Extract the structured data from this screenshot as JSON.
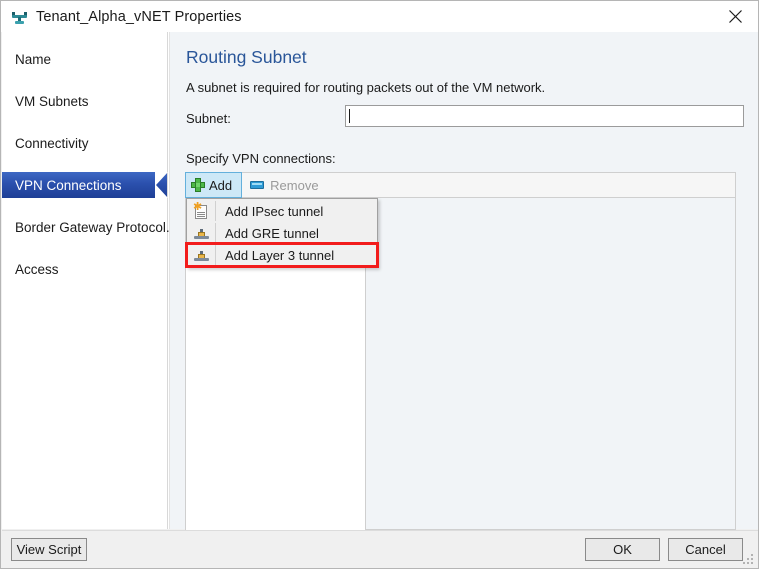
{
  "window": {
    "title": "Tenant_Alpha_vNET Properties",
    "icon": "network-adapter-icon",
    "close_label": "✕"
  },
  "sidebar": {
    "items": [
      {
        "label": "Name",
        "selected": false
      },
      {
        "label": "VM Subnets",
        "selected": false
      },
      {
        "label": "Connectivity",
        "selected": false
      },
      {
        "label": "VPN Connections",
        "selected": true
      },
      {
        "label": "Border Gateway Protocol...",
        "selected": false
      },
      {
        "label": "Access",
        "selected": false
      }
    ]
  },
  "content": {
    "title": "Routing Subnet",
    "description": "A subnet is required for routing packets out of the VM network.",
    "subnet_label": "Subnet:",
    "subnet_value": "",
    "subnet_placeholder": "",
    "specify_label": "Specify VPN connections:"
  },
  "toolbar": {
    "add_label": "Add",
    "add_icon": "green-plus-icon",
    "add_active": true,
    "remove_label": "Remove",
    "remove_icon": "blue-minus-icon",
    "remove_enabled": false
  },
  "dropdown": {
    "open": true,
    "items": [
      {
        "label": "Add IPsec tunnel",
        "icon": "new-document-icon",
        "highlighted": false
      },
      {
        "label": "Add GRE tunnel",
        "icon": "router-icon",
        "highlighted": false
      },
      {
        "label": "Add Layer 3 tunnel",
        "icon": "router-icon",
        "highlighted": true
      }
    ]
  },
  "list": {
    "items": []
  },
  "footer": {
    "view_script_label": "View Script",
    "ok_label": "OK",
    "cancel_label": "Cancel"
  },
  "colors": {
    "accent_blue": "#2a5699",
    "selection_blue": "#2b50ad",
    "highlight_red": "#f21c1c",
    "add_button_fill": "#cde8f7",
    "content_bg": "#f1f4f7"
  }
}
